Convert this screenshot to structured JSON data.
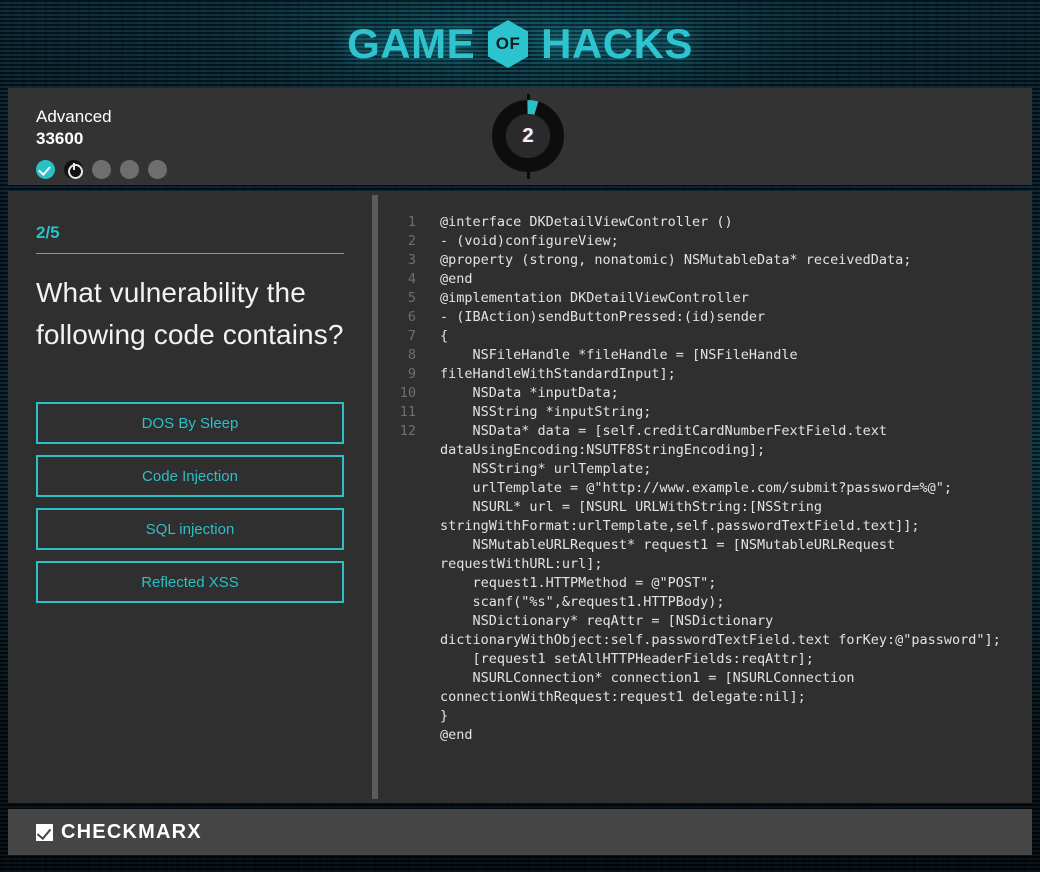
{
  "header": {
    "title_left": "GAME",
    "badge_label": "OF",
    "title_right": "HACKS",
    "accent_color": "#2ec4cf"
  },
  "scorebar": {
    "level_name": "Advanced",
    "score": "33600",
    "progress_dots": [
      {
        "state": "done"
      },
      {
        "state": "current"
      },
      {
        "state": "pending"
      },
      {
        "state": "pending"
      },
      {
        "state": "pending"
      }
    ],
    "timer": {
      "value": "2",
      "arc_color": "#2bbfc6",
      "ring_color": "#0d0d0d"
    }
  },
  "question": {
    "counter": "2/5",
    "text": "What vulnerability the following code contains?",
    "answers": [
      {
        "label": "DOS By Sleep"
      },
      {
        "label": "Code Injection"
      },
      {
        "label": "SQL injection"
      },
      {
        "label": "Reflected XSS"
      }
    ]
  },
  "code": {
    "line_numbers": [
      "1",
      "2",
      "3",
      "4",
      "5",
      "6",
      "7",
      "8",
      "9",
      "10",
      "11",
      "12"
    ],
    "text": "@interface DKDetailViewController ()\n- (void)configureView;\n@property (strong, nonatomic) NSMutableData* receivedData;\n@end\n@implementation DKDetailViewController\n- (IBAction)sendButtonPressed:(id)sender\n{\n    NSFileHandle *fileHandle = [NSFileHandle fileHandleWithStandardInput];\n    NSData *inputData;\n    NSString *inputString;\n    NSData* data = [self.creditCardNumberFextField.text dataUsingEncoding:NSUTF8StringEncoding];\n    NSString* urlTemplate;\n    urlTemplate = @\"http://www.example.com/submit?password=%@\";\n    NSURL* url = [NSURL URLWithString:[NSString stringWithFormat:urlTemplate,self.passwordTextField.text]];\n    NSMutableURLRequest* request1 = [NSMutableURLRequest requestWithURL:url];\n    request1.HTTPMethod = @\"POST\";\n    scanf(\"%s\",&request1.HTTPBody);\n    NSDictionary* reqAttr = [NSDictionary dictionaryWithObject:self.passwordTextField.text forKey:@\"password\"];\n    [request1 setAllHTTPHeaderFields:reqAttr];\n    NSURLConnection* connection1 = [NSURLConnection connectionWithRequest:request1 delegate:nil];\n}\n@end"
  },
  "footer": {
    "brand": "CHECKMARX"
  }
}
